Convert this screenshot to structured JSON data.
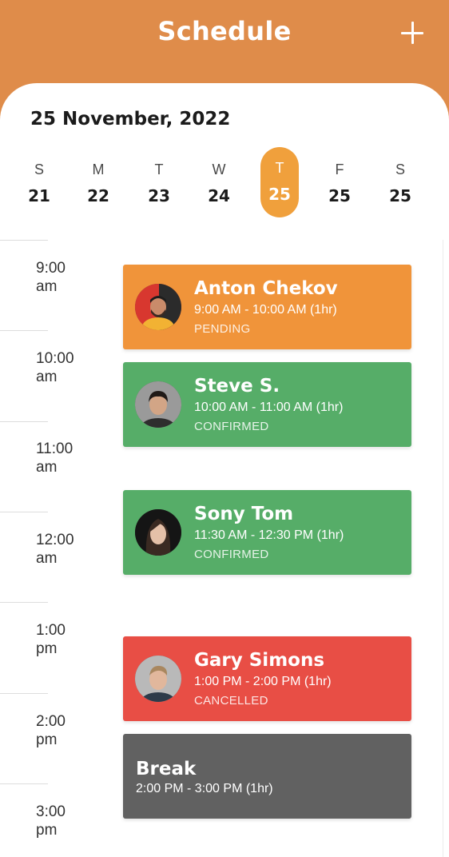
{
  "header": {
    "title": "Schedule",
    "add_icon": "plus-icon"
  },
  "date_label": "25 November, 2022",
  "week": [
    {
      "name": "S",
      "date": "21",
      "selected": false
    },
    {
      "name": "M",
      "date": "22",
      "selected": false
    },
    {
      "name": "T",
      "date": "23",
      "selected": false
    },
    {
      "name": "W",
      "date": "24",
      "selected": false
    },
    {
      "name": "T",
      "date": "25",
      "selected": true
    },
    {
      "name": "F",
      "date": "25",
      "selected": false
    },
    {
      "name": "S",
      "date": "25",
      "selected": false
    }
  ],
  "time_slots": [
    {
      "time": "9:00",
      "period": "am"
    },
    {
      "time": "10:00",
      "period": "am"
    },
    {
      "time": "11:00",
      "period": "am"
    },
    {
      "time": "12:00",
      "period": "am"
    },
    {
      "time": "1:00",
      "period": "pm"
    },
    {
      "time": "2:00",
      "period": "pm"
    },
    {
      "time": "3:00",
      "period": "pm"
    }
  ],
  "appointments": [
    {
      "name": "Anton Chekov",
      "time": "9:00 AM - 10:00 AM (1hr)",
      "status": "PENDING"
    },
    {
      "name": "Steve S.",
      "time": "10:00 AM - 11:00 AM (1hr)",
      "status": "CONFIRMED"
    },
    {
      "name": "Sony Tom",
      "time": "11:30 AM - 12:30 PM (1hr)",
      "status": "CONFIRMED"
    },
    {
      "name": "Gary Simons",
      "time": "1:00 PM - 2:00 PM (1hr)",
      "status": "CANCELLED"
    },
    {
      "name": "Break",
      "time": "2:00 PM - 3:00 PM (1hr)"
    }
  ],
  "colors": {
    "header": "#df8c4a",
    "selected_day": "#f0a03c",
    "pending": "#f0943a",
    "confirmed": "#56ad68",
    "cancelled": "#e84e45",
    "break": "#616161"
  }
}
